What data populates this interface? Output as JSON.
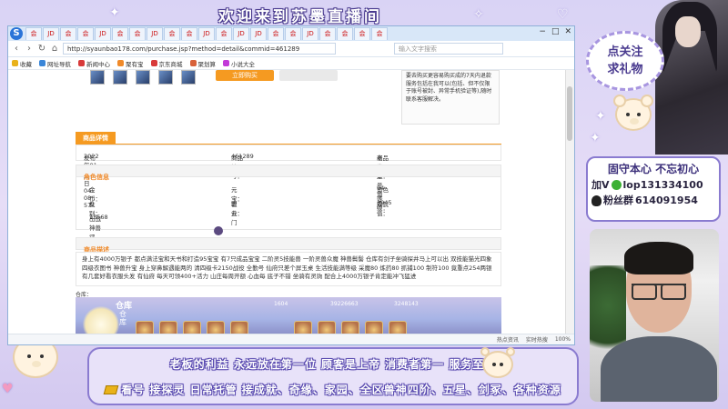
{
  "stream": {
    "title": "欢迎来到苏墨直播间",
    "follow_line1": "点关注",
    "follow_line2": "求礼物",
    "motto": "固守本心 不忘初心",
    "contact_wx_label": "加V",
    "contact_wx": "lop131334100",
    "contact_qq_label": "粉丝群",
    "contact_qq": "614091954",
    "banner_line1": "老板的利益 永远放在第一位 顾客是上帝 消费者第一 服务至上",
    "banner_line2": "看号  接探灵 日常托管  接成就、奇缘、家园、全区兽神四阶、五星、剑冢、各种资源"
  },
  "browser": {
    "tab_icon_text": "JD",
    "active_tab": "会",
    "url": "http://syaunbao178.com/purchase.jsp?method=detail&commid=461289",
    "search_placeholder": "输入文字搜索",
    "bookmarks": [
      "收藏",
      "网址导航",
      "新闻中心",
      "聚有宝",
      "京东商城",
      "聚划算",
      "小说大全"
    ],
    "status": [
      "热点资讯",
      "实时热搜",
      "100%"
    ]
  },
  "page": {
    "buy_button": "立即购买",
    "side_note": "要去购买更容易购买成的7天内退款服务包括在我可以(包括、但不仅限于账号被封、异常手机验证等),随时联系客服解决。",
    "section_detail": "商品详情",
    "publish_label": "发布时间：",
    "publish_time": "2022年01月17日 04 : 08 : 57",
    "item_no_label": "商品编号：",
    "item_no": "461289",
    "item_type_label": "商品类型：",
    "item_type": "老虎账号角色",
    "section_role": "角色信息",
    "money_label": "金币：",
    "money": "",
    "yuanbao_label": "元宝：",
    "yuanbao": "",
    "level_label": "角色等级：",
    "level": "94",
    "gender_label": "性别：",
    "gender": "女",
    "job_label": "职业：",
    "job": "青云门",
    "achieve_label": "成就值：",
    "achieve": "3945",
    "score_label": "出战神兽评分：",
    "score": "13568",
    "section_desc": "商品描述",
    "description": "身上有4000万银子 都点满法宝和天书和打造95宝宝 有7只成品宝宝 二阶灵5技能兽 一阶灵兽众魔 神兽鬓髻 仓库有剑子坐骑探井马上可以出 双技能猫光四象 四级衣图书 神兽升宝 身上穿鼻解遇能两的 清四级卡2150战役 全勤号 仙府只差个屏玉桌 生活技能满等级 采魔80 炼药80 抓捕100 制符100 竟重点254两银 有几套好看衣服头发 有仙府 每天可领400+活力 山庄每周开额 心血每 底子不错 坐骑有灵驹 配合上4000万银子肯定能冲飞猛进",
    "img_caption": "仓库：",
    "game_title": "仓库",
    "game_side": "仓库",
    "game_stats": [
      "1604",
      "39226663",
      "3248143"
    ]
  },
  "colors": {
    "accent": "#f59a21",
    "frame": "#8a7bd0",
    "bg": "#d9d3f5"
  }
}
